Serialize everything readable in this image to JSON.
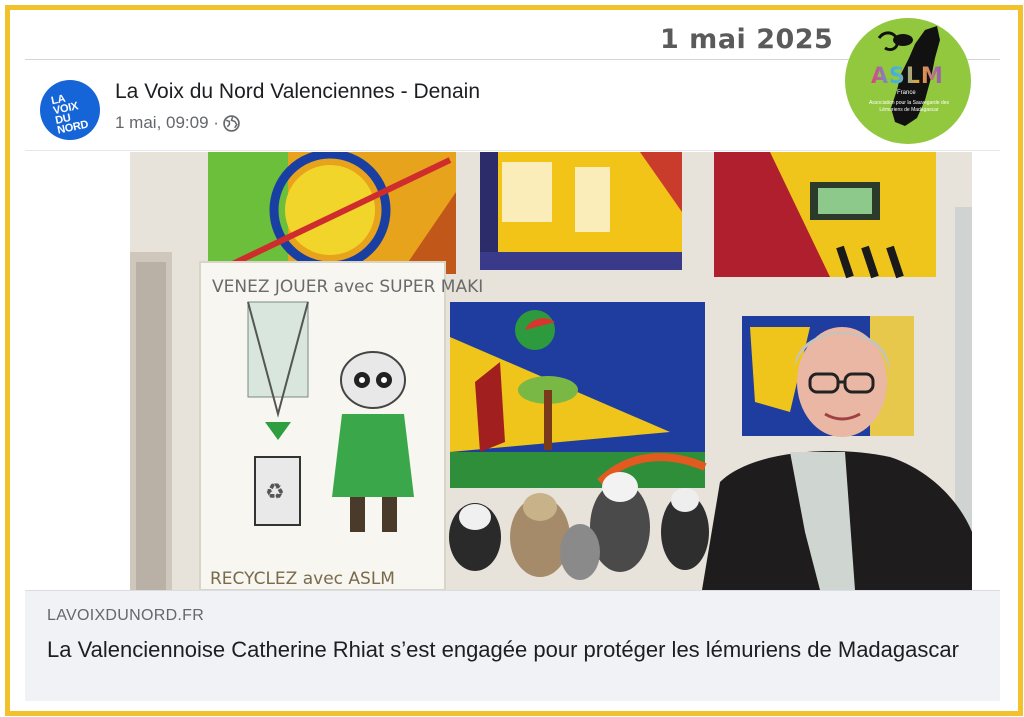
{
  "date_label": "1 mai 2025",
  "brand_logo": {
    "text": "ASLM",
    "country": "France",
    "tagline": "Association pour la Sauvegarde des Lémuriens de Madagascar",
    "bg_color": "#92c83e"
  },
  "post": {
    "avatar_text": "LA VOIX DU NORD",
    "avatar_color": "#1565d8",
    "page_name": "La Voix du Nord Valenciennes - Denain",
    "timestamp": "1 mai, 09:09 ·",
    "audience_icon": "globe-icon"
  },
  "photo": {
    "board_top_text": "VENEZ JOUER avec SUPER MAKI",
    "board_bottom_text": "RECYCLEZ avec ASLM"
  },
  "link_preview": {
    "domain": "LAVOIXDUNORD.FR",
    "title": "La Valenciennoise Catherine Rhiat s’est engagée pour protéger les lémuriens de Madagascar"
  }
}
